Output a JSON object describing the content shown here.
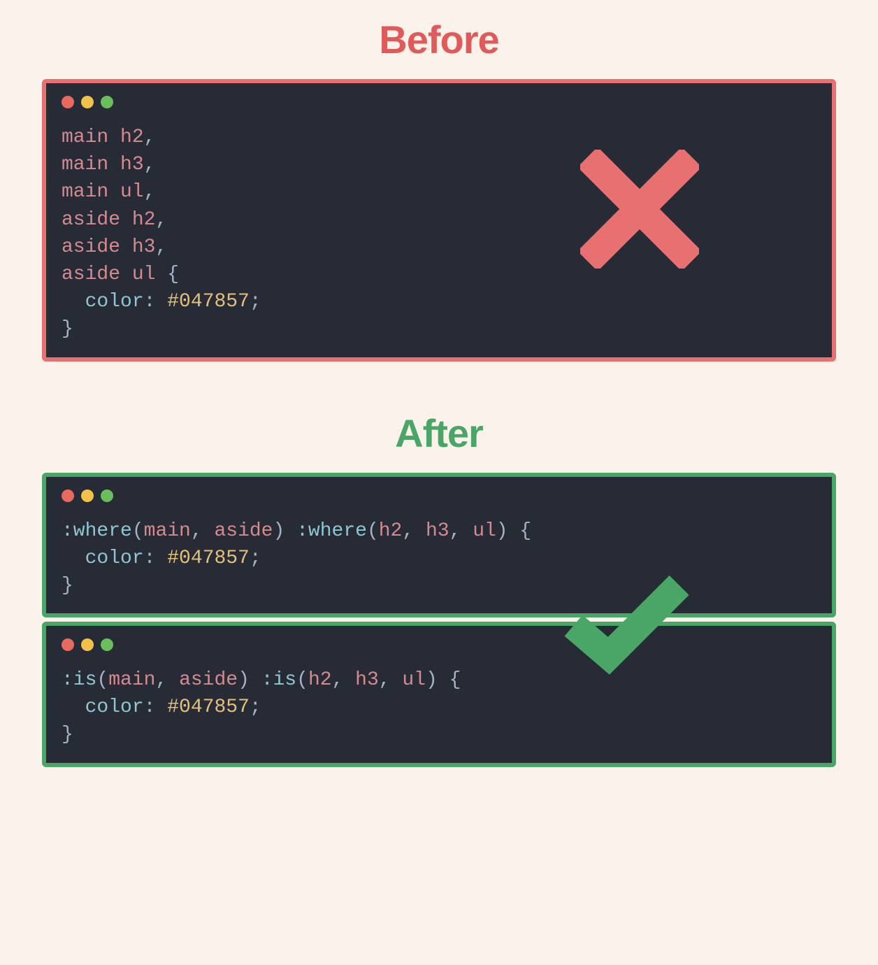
{
  "colors": {
    "background": "#fcf2ec",
    "before_accent": "#e05a5a",
    "after_accent": "#4aa666",
    "editor_bg": "#272b36",
    "token_tag": "#d58a8f",
    "token_prop": "#8fc7d0",
    "token_value": "#e4c17b"
  },
  "before": {
    "title": "Before",
    "code": {
      "selectors": [
        "main h2",
        "main h3",
        "main ul",
        "aside h2",
        "aside h3",
        "aside ul"
      ],
      "property": "color",
      "value": "#047857"
    }
  },
  "after": {
    "title": "After",
    "snippets": [
      {
        "selector_fn": ":where",
        "groups": [
          [
            "main",
            "aside"
          ],
          [
            "h2",
            "h3",
            "ul"
          ]
        ],
        "property": "color",
        "value": "#047857"
      },
      {
        "selector_fn": ":is",
        "groups": [
          [
            "main",
            "aside"
          ],
          [
            "h2",
            "h3",
            "ul"
          ]
        ],
        "property": "color",
        "value": "#047857"
      }
    ]
  },
  "labels": {
    "before_sel_0": "main h2",
    "before_sel_1": "main h3",
    "before_sel_2": "main ul",
    "before_sel_3": "aside h2",
    "before_sel_4": "aside h3",
    "before_sel_5": "aside ul",
    "prop": "color",
    "val": "#047857",
    "fn_where": ":where",
    "fn_is": ":is",
    "g_main": "main",
    "g_aside": "aside",
    "g_h2": "h2",
    "g_h3": "h3",
    "g_ul": "ul",
    "comma_sp": ", ",
    "comma": ",",
    "open_p": "(",
    "close_p": ")",
    "open_b": " {",
    "close_b": "}",
    "colon": ": ",
    "semi": ";",
    "indent": "  ",
    "sp": " "
  }
}
